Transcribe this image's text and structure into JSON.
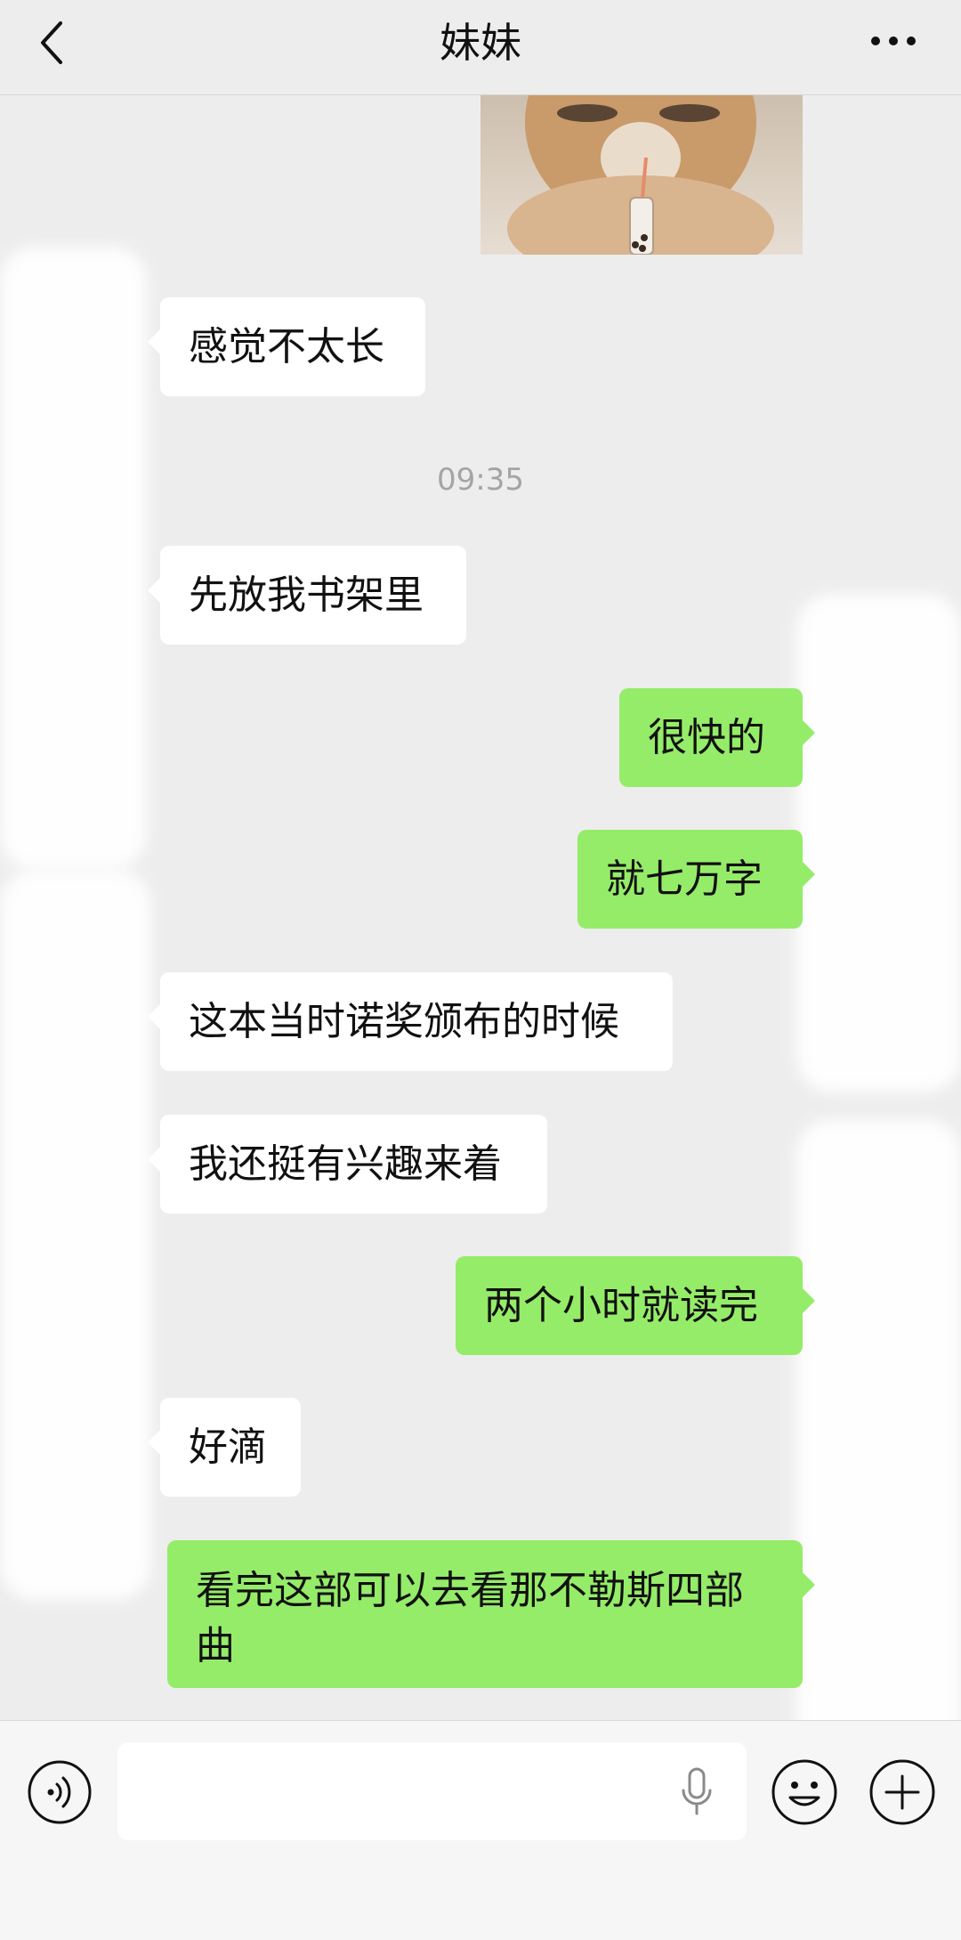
{
  "header": {
    "title": "妹妹"
  },
  "messages": [
    {
      "side": "left",
      "text": "感觉不太长"
    },
    {
      "side": "left",
      "text": "先放我书架里"
    },
    {
      "side": "right",
      "text": "很快的"
    },
    {
      "side": "right",
      "text": "就七万字"
    },
    {
      "side": "left",
      "text": "这本当时诺奖颁布的时候"
    },
    {
      "side": "left",
      "text": "我还挺有兴趣来着"
    },
    {
      "side": "right",
      "text": "两个小时就读完"
    },
    {
      "side": "left",
      "text": "好滴"
    },
    {
      "side": "right",
      "text_lines": [
        "看完这部可以去看那不勒斯四部",
        "曲"
      ]
    }
  ],
  "timestamp": "09:35",
  "input": {
    "value": "",
    "placeholder": ""
  },
  "icons": {
    "back": "chevron-left-icon",
    "more": "more-icon",
    "voice": "voice-input-icon",
    "mic": "microphone-icon",
    "emoji": "emoji-icon",
    "plus": "plus-icon"
  },
  "colors": {
    "background": "#ededed",
    "sent_bubble": "#95ec69",
    "received_bubble": "#ffffff"
  }
}
